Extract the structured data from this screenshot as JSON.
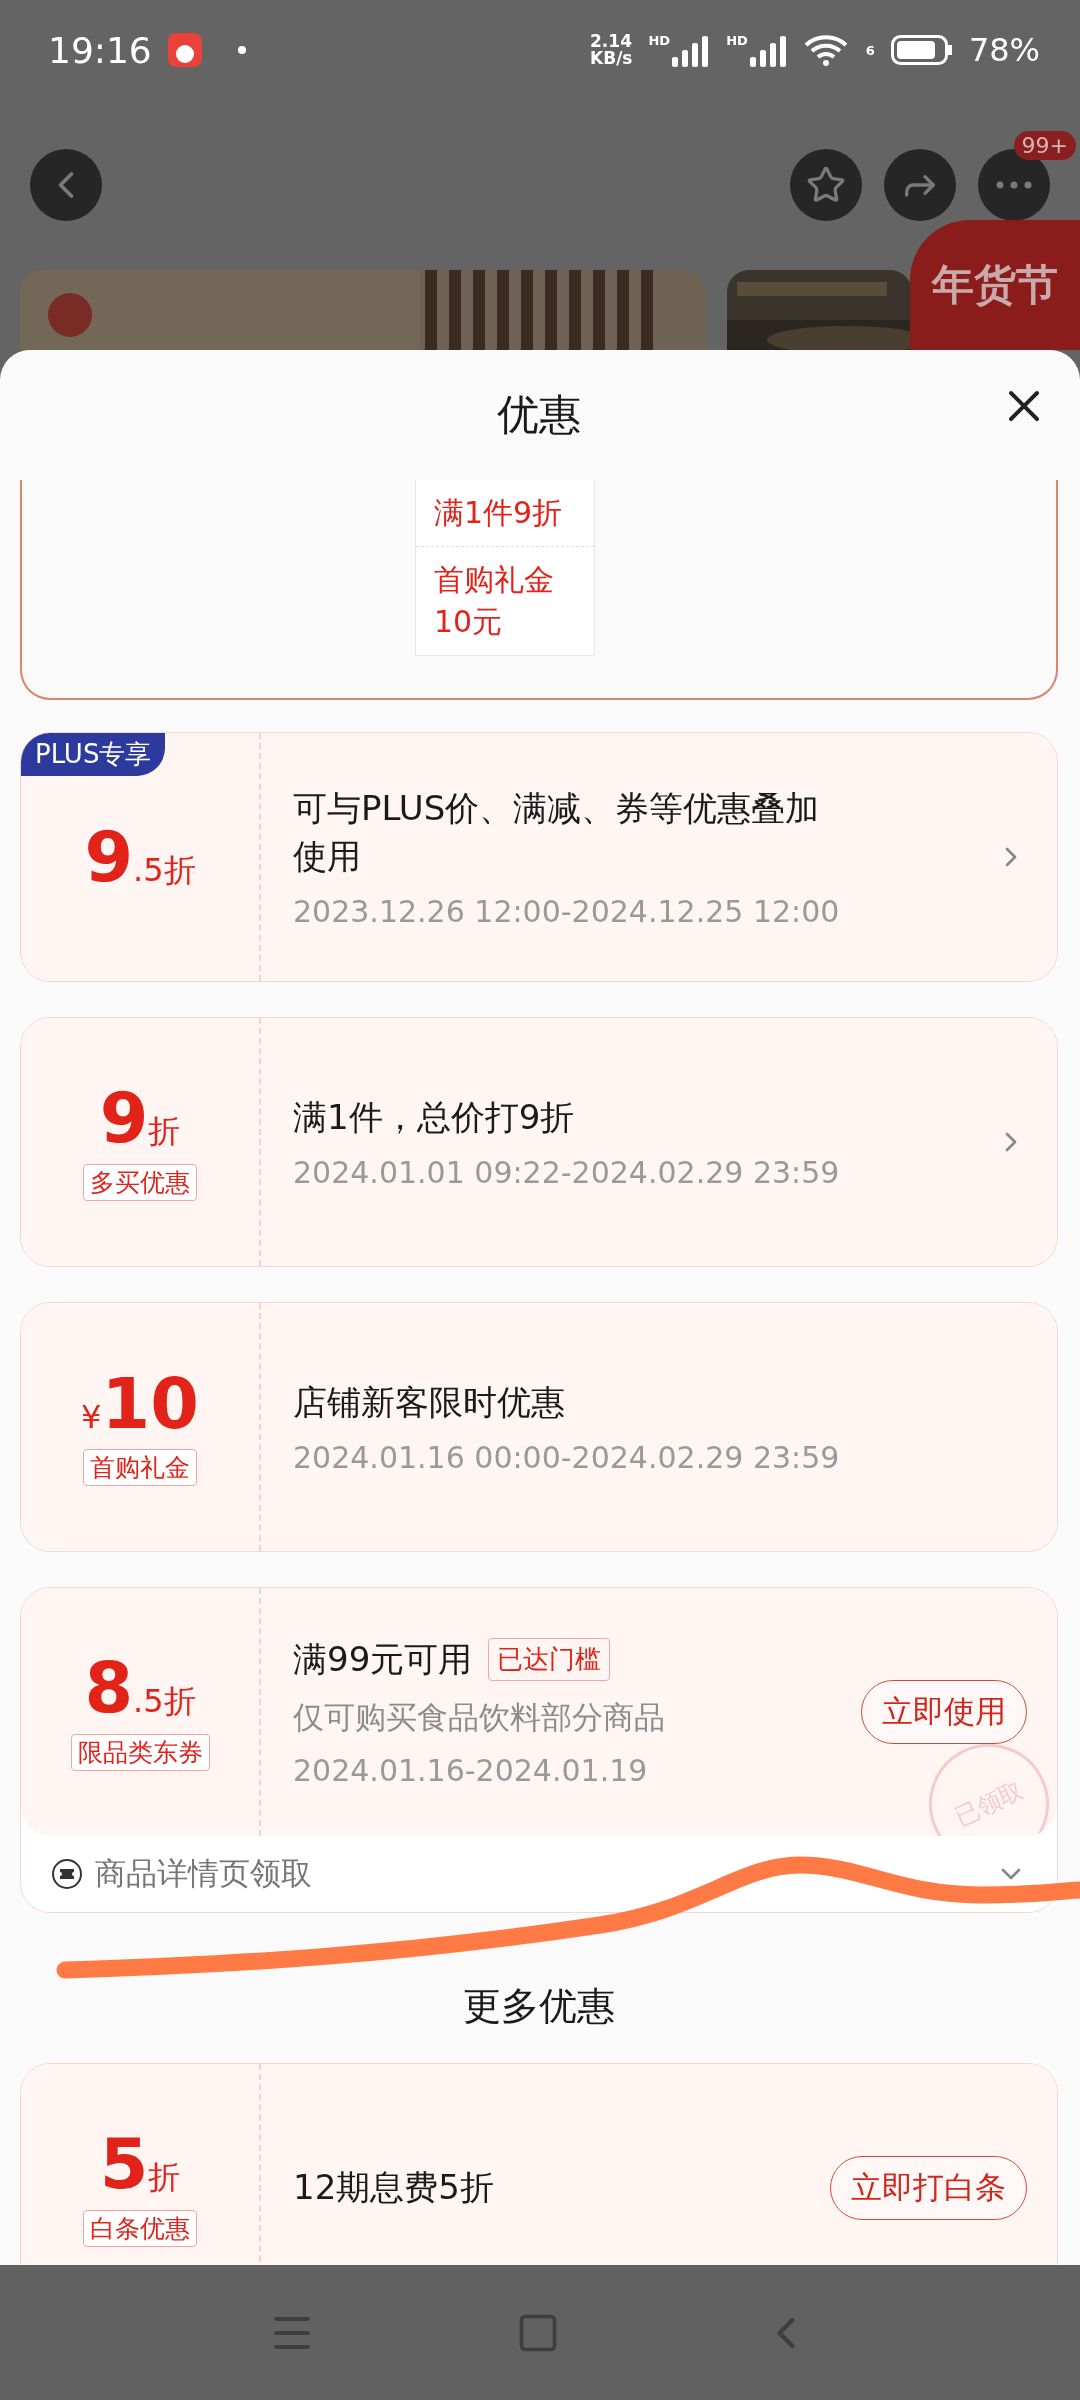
{
  "status_bar": {
    "time": "19:16",
    "network_speed": [
      "2.14",
      "KB/s"
    ],
    "signals": [
      "HD",
      "HD"
    ],
    "wifi_label": "6",
    "battery": "78%"
  },
  "header": {
    "notification_badge": "99+"
  },
  "banner": {
    "festival_badge": "年货节"
  },
  "sheet": {
    "title": "优惠"
  },
  "summary_card": {
    "items": [
      "满1件9折",
      "首购礼金10元"
    ]
  },
  "offers": [
    {
      "value": "9",
      "suffix": ".5折",
      "corner_badge": "PLUS专享",
      "title": "可与PLUS价、满减、券等优惠叠加使用",
      "date": "2023.12.26 12:00-2024.12.25 12:00",
      "action": {
        "kind": "chevron"
      }
    },
    {
      "value": "9",
      "suffix": "折",
      "tag": "多买优惠",
      "title": "满1件，总价打9折",
      "date": "2024.01.01 09:22-2024.02.29 23:59",
      "action": {
        "kind": "chevron"
      }
    },
    {
      "prefix": "¥",
      "value": "10",
      "tag": "首购礼金",
      "title": "店铺新客限时优惠",
      "date": "2024.01.16 00:00-2024.02.29 23:59"
    },
    {
      "value": "8",
      "suffix": ".5折",
      "tag": "限品类东券",
      "title": "满99元可用",
      "title_badge": "已达门槛",
      "subtitle": "仅可购买食品饮料部分商品",
      "date": "2024.01.16-2024.01.19",
      "action": {
        "kind": "button",
        "label": "立即使用"
      },
      "stamp": "已领取",
      "footer": "商品详情页领取"
    }
  ],
  "more_section": {
    "title": "更多优惠",
    "offers": [
      {
        "value": "5",
        "suffix": "折",
        "tag": "白条优惠",
        "title": "12期息费5折",
        "action": {
          "kind": "button",
          "label": "立即打白条"
        }
      }
    ]
  }
}
